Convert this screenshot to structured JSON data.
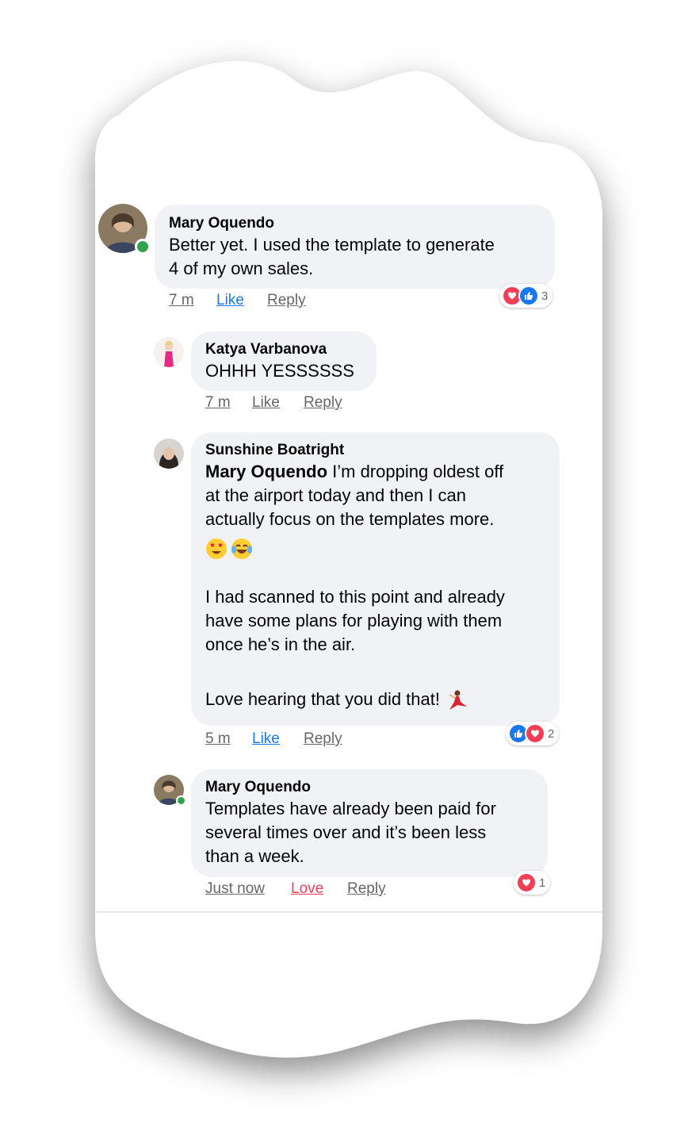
{
  "comments": [
    {
      "author": "Mary Oquendo",
      "lines": [
        "Better yet. I used the template to generate",
        "4 of my own sales."
      ],
      "time": "7 m",
      "like": "Like",
      "reply": "Reply",
      "reaction_count": "3"
    },
    {
      "author": "Katya Varbanova",
      "lines": [
        "OHHH YESSSSSS"
      ],
      "time": "7 m",
      "like": "Like",
      "reply": "Reply"
    },
    {
      "author": "Sunshine Boatright",
      "mention": "Mary Oquendo",
      "line1_rest": " I’m dropping oldest off",
      "lines": [
        "at the airport today and then I can",
        "actually focus on the templates more."
      ],
      "para2": [
        "I had scanned to this point and already",
        "have some plans for playing with them",
        "once he’s in the air."
      ],
      "para3": "Love hearing that you did that!",
      "time": "5 m",
      "like": "Like",
      "reply": "Reply",
      "reaction_count": "2"
    },
    {
      "author": "Mary Oquendo",
      "lines": [
        "Templates have already been paid for",
        "several times over and it’s been less",
        "than a week."
      ],
      "time": "Just now",
      "love": "Love",
      "reply": "Reply",
      "reaction_count": "1"
    }
  ],
  "colors": {
    "bubble": "#f0f2f5",
    "like_blue": "#1877f2",
    "love_red": "#f33e58",
    "meta_gray": "#65676b",
    "online_green": "#31a24c"
  },
  "icons": [
    "heart-reaction-icon",
    "thumbs-up-reaction-icon",
    "heart-eyes-emoji-icon",
    "tears-of-joy-emoji-icon",
    "dancer-emoji-icon"
  ]
}
